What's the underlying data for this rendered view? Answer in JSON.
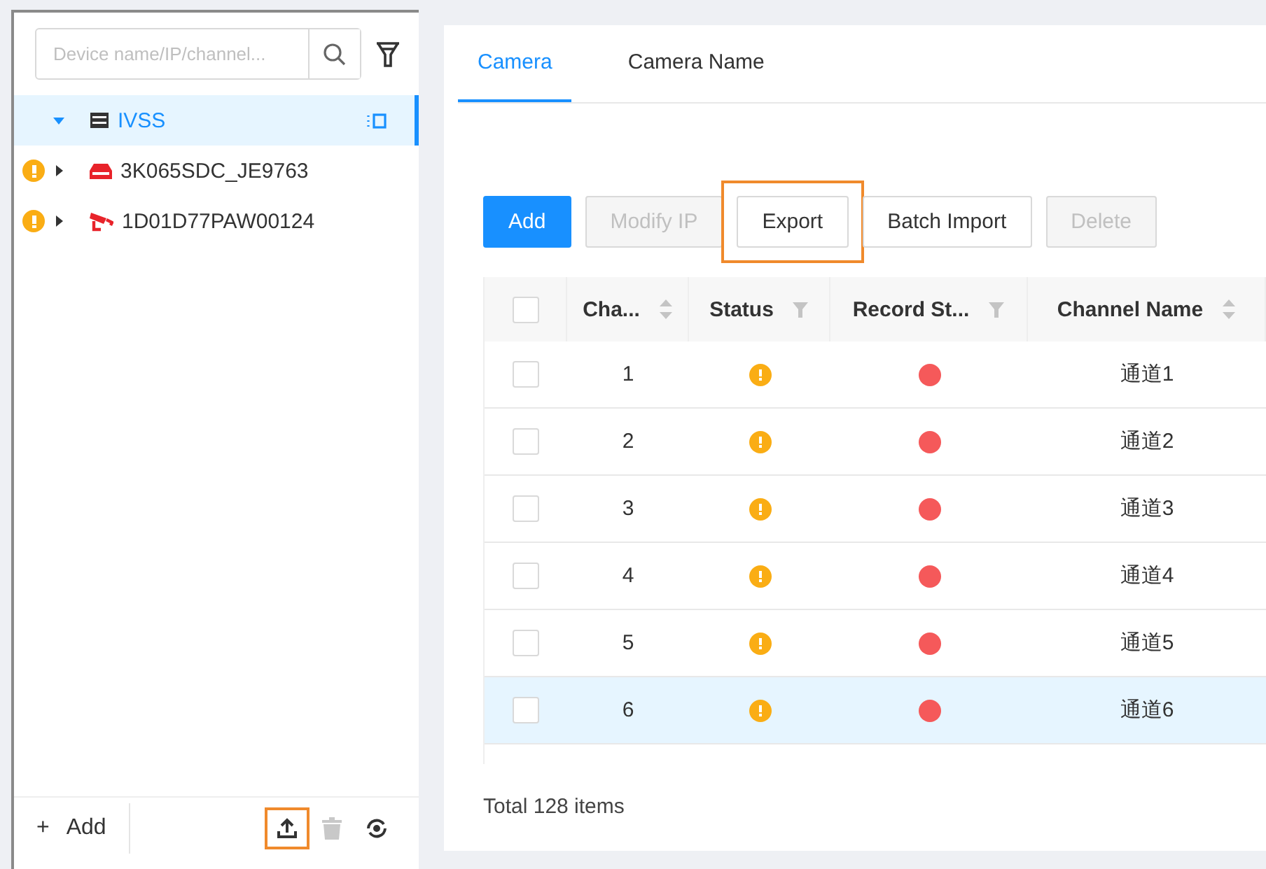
{
  "sidebar": {
    "search": {
      "placeholder": "Device name/IP/channel..."
    },
    "tree": [
      {
        "label": "IVSS",
        "kind": "server",
        "selected": true,
        "expanded": true,
        "warning": false,
        "children": [
          {
            "label": "3K065SDC_JE9763",
            "kind": "recorder",
            "selected": false,
            "expanded": false,
            "warning": true
          },
          {
            "label": "1D01D77PAW00124",
            "kind": "camera",
            "selected": false,
            "expanded": false,
            "warning": true
          }
        ]
      }
    ],
    "footer": {
      "add_label": "+",
      "add_text": "Add",
      "icons": [
        {
          "kind": "upload",
          "disabled": false,
          "highlighted": true
        },
        {
          "kind": "trash",
          "disabled": true,
          "highlighted": false
        },
        {
          "kind": "refresh",
          "disabled": false,
          "highlighted": false
        }
      ]
    }
  },
  "tabs": [
    {
      "label": "Camera",
      "selected": true
    },
    {
      "label": "Camera Name",
      "selected": false
    }
  ],
  "toolbar": [
    {
      "label": "Add",
      "kind": "primary"
    },
    {
      "label": "Modify IP",
      "kind": "default",
      "disabled": true,
      "highlighted": false
    },
    {
      "label": "Export",
      "kind": "default",
      "disabled": false,
      "highlighted": true
    },
    {
      "label": "Batch Import",
      "kind": "default",
      "disabled": false,
      "highlighted": false
    },
    {
      "label": "Delete",
      "kind": "default",
      "disabled": true,
      "highlighted": false
    }
  ],
  "table": {
    "all_checked": false,
    "columns": [
      {
        "label": "Cha...",
        "kind": "sort"
      },
      {
        "label": "Status",
        "kind": "filter"
      },
      {
        "label": "Record St...",
        "kind": "filter"
      },
      {
        "label": "Channel Name",
        "kind": "sort"
      }
    ],
    "rows": [
      {
        "channel": "1",
        "name": "通道1",
        "selected": false,
        "checked": false
      },
      {
        "channel": "2",
        "name": "通道2",
        "selected": false,
        "checked": false
      },
      {
        "channel": "3",
        "name": "通道3",
        "selected": false,
        "checked": false
      },
      {
        "channel": "4",
        "name": "通道4",
        "selected": false,
        "checked": false
      },
      {
        "channel": "5",
        "name": "通道5",
        "selected": false,
        "checked": false
      },
      {
        "channel": "6",
        "name": "通道6",
        "selected": true,
        "checked": false
      }
    ]
  },
  "total": "Total 128 items"
}
